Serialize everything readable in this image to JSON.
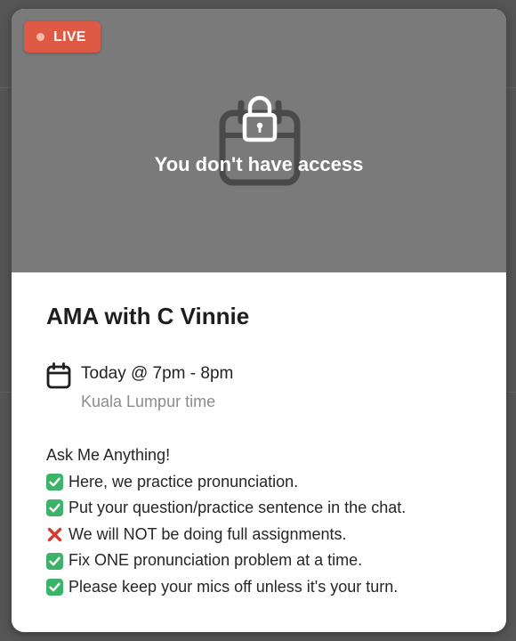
{
  "hero": {
    "live_label": "LIVE",
    "access_message": "You don't have access"
  },
  "event": {
    "title": "AMA with C Vinnie",
    "time": "Today @ 7pm - 8pm",
    "timezone": "Kuala Lumpur time"
  },
  "description": {
    "intro": "Ask Me Anything!",
    "items": [
      {
        "icon": "check-mark-icon",
        "text": "Here, we practice pronunciation."
      },
      {
        "icon": "check-mark-icon",
        "text": "Put your question/practice sentence in the chat."
      },
      {
        "icon": "cross-mark-icon",
        "text": "We will NOT be doing full assignments."
      },
      {
        "icon": "check-mark-icon",
        "text": "Fix ONE pronunciation problem at a time."
      },
      {
        "icon": "check-mark-icon",
        "text": "Please keep your mics off unless it's your turn."
      }
    ]
  },
  "colors": {
    "live_badge": "#de5a45",
    "hero_bg": "#7a7a7a",
    "check_green": "#3db36a",
    "cross_red": "#d93a2b"
  }
}
